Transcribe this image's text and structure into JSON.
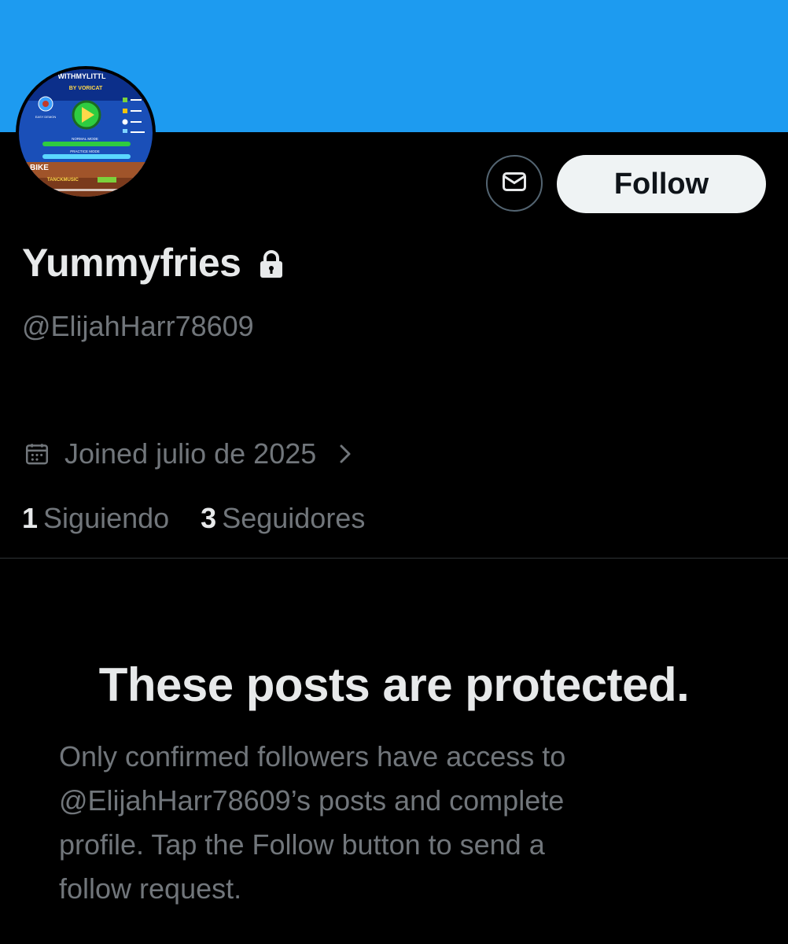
{
  "colors": {
    "banner": "#1d9bf0",
    "background": "#000000",
    "primary_text": "#e7e9ea",
    "secondary_text": "#71767b",
    "follow_button_bg": "#eff3f4",
    "follow_button_text": "#0f1419"
  },
  "avatar": {
    "image_text": {
      "title": "WITHMYLITTL",
      "author": "BY VORICAT",
      "difficulty": "EASY DEMON",
      "modes": [
        "NORMAL MODE",
        "PRACTICE MODE"
      ],
      "song": "BIKE",
      "artist": "TANCKMUSIC"
    }
  },
  "actions": {
    "message_icon": "envelope-icon",
    "follow_label": "Follow"
  },
  "profile": {
    "display_name": "Yummyfries",
    "lock_icon": "lock-icon",
    "handle": "@ElijahHarr78609",
    "joined_icon": "calendar-icon",
    "joined": "Joined julio de 2025",
    "chevron_icon": "chevron-right-icon"
  },
  "stats": {
    "following_count": "1",
    "following_label": "Siguiendo",
    "followers_count": "3",
    "followers_label": "Seguidores"
  },
  "protected": {
    "title": "These posts are protected.",
    "body_line_1": "Only confirmed followers have access to",
    "body_line_2": "@ElijahHarr78609’s posts and complete",
    "body_line_3": "profile. Tap the Follow button to send a",
    "body_line_4": "follow request."
  }
}
